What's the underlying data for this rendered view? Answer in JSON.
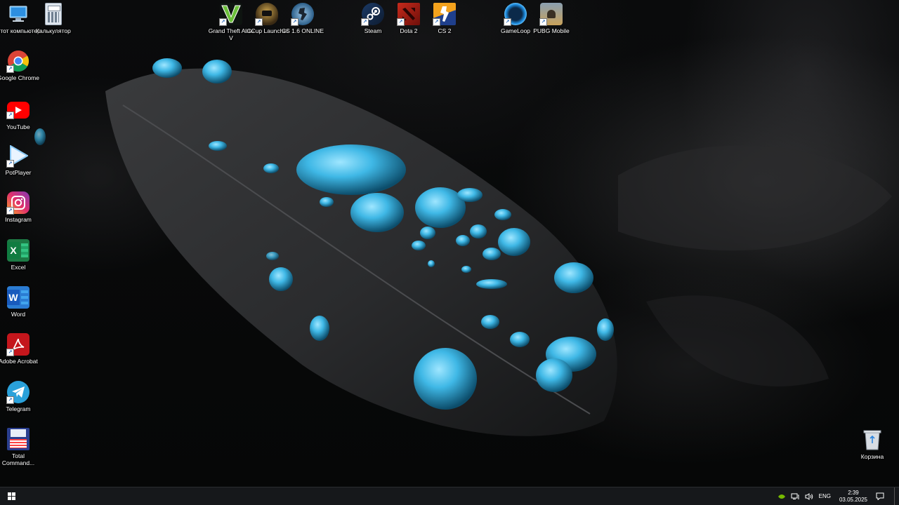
{
  "desktop": {
    "icons_left": [
      {
        "label": "Этот компьютер",
        "icon": "computer-icon"
      },
      {
        "label": "Google Chrome",
        "icon": "chrome-icon"
      },
      {
        "label": "YouTube",
        "icon": "youtube-icon"
      },
      {
        "label": "PotPlayer",
        "icon": "potplayer-icon"
      },
      {
        "label": "Instagram",
        "icon": "instagram-icon"
      },
      {
        "label": "Excel",
        "icon": "excel-icon"
      },
      {
        "label": "Word",
        "icon": "word-icon"
      },
      {
        "label": "Adobe Acrobat",
        "icon": "acrobat-icon"
      },
      {
        "label": "Telegram",
        "icon": "telegram-icon"
      },
      {
        "label": "Total Command...",
        "icon": "total-commander-icon"
      }
    ],
    "icons_top": [
      {
        "label": "Калькулятор",
        "icon": "calculator-icon"
      },
      {
        "label": "Grand Theft Auto V",
        "icon": "gta5-icon"
      },
      {
        "label": "ICCup Launcher",
        "icon": "iccup-icon"
      },
      {
        "label": "CS 1.6 ONLINE",
        "icon": "cs16-icon"
      },
      {
        "label": "Steam",
        "icon": "steam-icon"
      },
      {
        "label": "Dota 2",
        "icon": "dota2-icon"
      },
      {
        "label": "CS 2",
        "icon": "cs2-icon"
      },
      {
        "label": "GameLoop",
        "icon": "gameloop-icon"
      },
      {
        "label": "PUBG Mobile",
        "icon": "pubg-icon"
      }
    ],
    "recycle_bin": {
      "label": "Корзина",
      "icon": "recycle-bin-icon"
    }
  },
  "taskbar": {
    "language": "ENG",
    "time": "2:39",
    "date": "03.05.2025"
  }
}
